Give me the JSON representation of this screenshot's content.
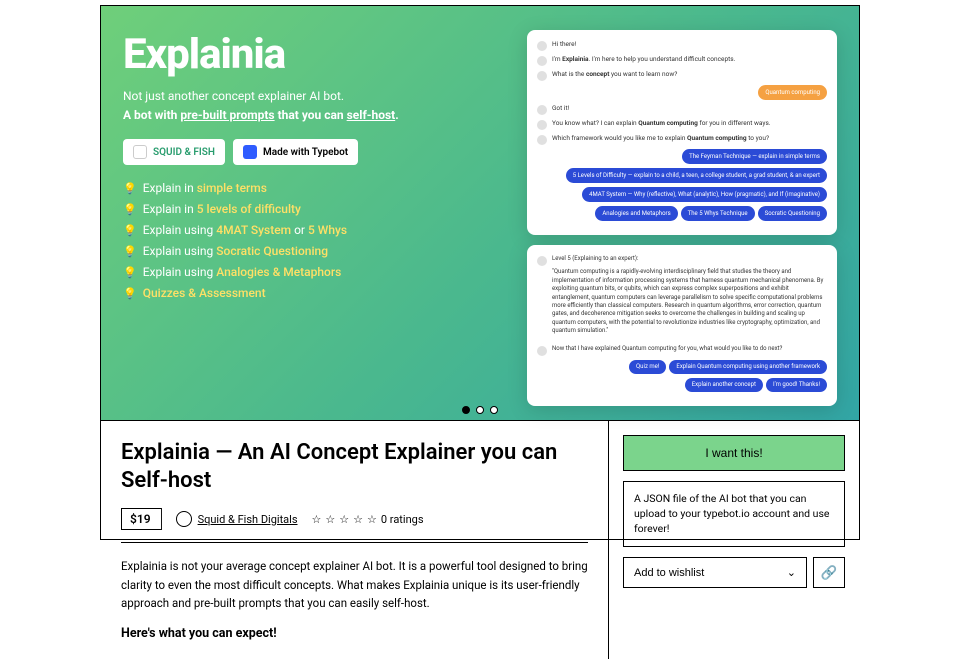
{
  "hero": {
    "title": "Explainia",
    "sub_line1": "Not just another concept explainer AI bot.",
    "sub_line2_a": "A bot with ",
    "sub_line2_b": "pre-built prompts",
    "sub_line2_c": " that you can ",
    "sub_line2_d": "self-host",
    "sub_line2_e": "."
  },
  "badges": {
    "sf": "SQUID & FISH",
    "tb": "Made with Typebot"
  },
  "features": [
    {
      "a": "Explain in ",
      "b": "simple terms"
    },
    {
      "a": "Explain in ",
      "b": "5 levels of difficulty"
    },
    {
      "a": "Explain using ",
      "b": "4MAT System",
      "c": " or ",
      "d": "5 Whys"
    },
    {
      "a": "Explain using ",
      "b": "Socratic Questioning"
    },
    {
      "a": "Explain using ",
      "b": "Analogies & Metaphors"
    },
    {
      "a": "",
      "b": "Quizzes & Assessment"
    }
  ],
  "chat1": {
    "m1": "Hi there!",
    "m2a": "I'm ",
    "m2b": "Explainia",
    "m2c": ". I'm here to help you understand difficult concepts.",
    "m3a": "What is the ",
    "m3b": "concept",
    "m3c": " you want to learn now?",
    "user": "Quantum computing",
    "m4": "Got it!",
    "m5a": "You know what? I can explain ",
    "m5b": "Quantum computing",
    "m5c": " for you in different ways.",
    "m6a": "Which framework would you like me to explain ",
    "m6b": "Quantum computing",
    "m6c": " to you?",
    "c1": "The Feyman Technique — explain in simple terms",
    "c2": "5 Levels of Difficulty — explain to a child, a teen, a college student, a grad student, & an expert",
    "c3": "4MAT System — Why (reflective), What (analytic), How (pragmatic), and If (imaginative)",
    "c4": "Analogies and Metaphors",
    "c5": "The 5 Whys Technique",
    "c6": "Socratic Questioning"
  },
  "chat2": {
    "head": "Level 5 (Explaining to an expert):",
    "body": "\"Quantum computing is a rapidly-evolving interdisciplinary field that studies the theory and implementation of information processing systems that harness quantum mechanical phenomena. By exploiting quantum bits, or qubits, which can express complex superpositions and exhibit entanglement, quantum computers can leverage parallelism to solve specific computational problems more efficiently than classical computers. Research in quantum algorithms, error correction, quantum gates, and decoherence mitigation seeks to overcome the challenges in building and scaling up quantum computers, with the potential to revolutionize industries like cryptography, optimization, and quantum simulation.\"",
    "m": "Now that I have explained Quantum computing for you, what would you like to do next?",
    "b1": "Quiz me!",
    "b2": "Explain Quantum computing using another framework",
    "b3": "Explain another concept",
    "b4": "I'm good! Thanks!"
  },
  "product": {
    "title": "Explainia — An AI Concept Explainer you can Self-host",
    "price": "$19",
    "seller": "Squid & Fish Digitals",
    "ratings": "0 ratings",
    "desc": "Explainia is not your average concept explainer AI bot. It is a powerful tool designed to bring clarity to even the most difficult concepts. What makes Explainia unique is its user-friendly approach and pre-built prompts that you can easily self-host.",
    "expect": "Here's what you can expect!"
  },
  "side": {
    "want": "I want this!",
    "info": "A JSON file of the AI bot that you can upload to your typebot.io account and use forever!",
    "wish": "Add to wishlist"
  }
}
